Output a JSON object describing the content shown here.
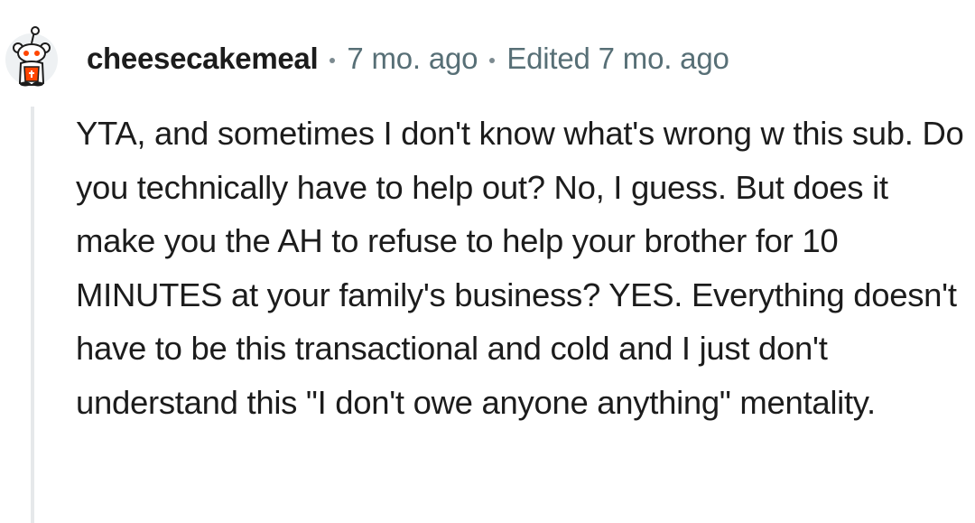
{
  "comment": {
    "username": "cheesecakemeal",
    "age": "7 mo. ago",
    "edited": "Edited 7 mo. ago",
    "avatar_icon": "snoo-avatar-icon",
    "body": "YTA, and sometimes I don't know what's wrong w this sub. Do you technically have to help out? No, I guess. But does it make you the AH to refuse to help your brother for 10 MINUTES at your family's business? YES. Everything doesn't have to be this transactional and cold and I just don't understand this \"I don't owe anyone anything\" mentality."
  },
  "colors": {
    "text": "#1c1c1c",
    "meta": "#576f76",
    "thread_line": "#e6e8ea",
    "avatar_accent": "#ff4500",
    "avatar_bg": "#eef1f3"
  }
}
